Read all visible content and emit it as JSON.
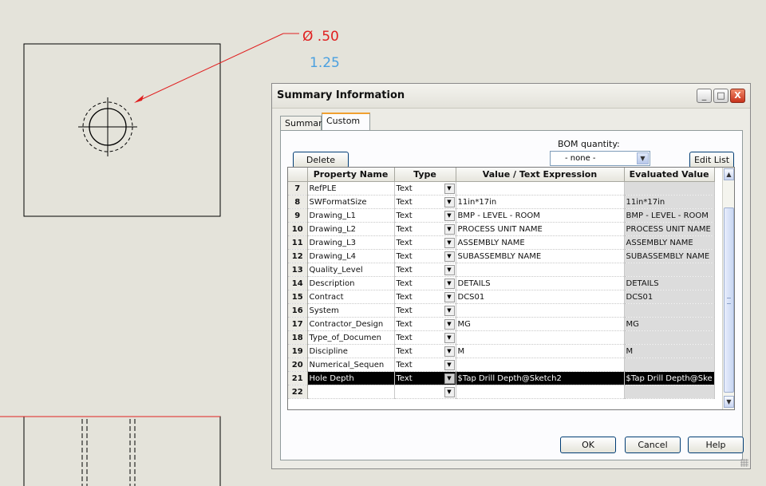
{
  "drawing": {
    "dim_diameter": "Ø .50",
    "dim_depth": "1.25"
  },
  "dialog": {
    "title": "Summary Information",
    "window_buttons": {
      "minimize": "_",
      "maximize": "□",
      "close": "X"
    },
    "tabs": [
      {
        "label": "Summary",
        "active": false
      },
      {
        "label": "Custom",
        "active": true
      }
    ],
    "delete_label": "Delete",
    "bom_label": "BOM quantity:",
    "bom_value": "- none -",
    "edit_list_label": "Edit List",
    "columns": [
      "Property Name",
      "Type",
      "Value / Text Expression",
      "Evaluated Value"
    ],
    "rows": [
      {
        "num": "7",
        "name": "RefPLE",
        "type": "Text",
        "value": "",
        "evaluated": ""
      },
      {
        "num": "8",
        "name": "SWFormatSize",
        "type": "Text",
        "value": "11in*17in",
        "evaluated": "11in*17in"
      },
      {
        "num": "9",
        "name": "Drawing_L1",
        "type": "Text",
        "value": "BMP - LEVEL - ROOM",
        "evaluated": "BMP - LEVEL - ROOM"
      },
      {
        "num": "10",
        "name": "Drawing_L2",
        "type": "Text",
        "value": "PROCESS UNIT NAME",
        "evaluated": "PROCESS UNIT NAME"
      },
      {
        "num": "11",
        "name": "Drawing_L3",
        "type": "Text",
        "value": "ASSEMBLY NAME",
        "evaluated": "ASSEMBLY NAME"
      },
      {
        "num": "12",
        "name": "Drawing_L4",
        "type": "Text",
        "value": "SUBASSEMBLY NAME",
        "evaluated": "SUBASSEMBLY NAME"
      },
      {
        "num": "13",
        "name": "Quality_Level",
        "type": "Text",
        "value": "",
        "evaluated": ""
      },
      {
        "num": "14",
        "name": "Description",
        "type": "Text",
        "value": "DETAILS",
        "evaluated": "DETAILS"
      },
      {
        "num": "15",
        "name": "Contract",
        "type": "Text",
        "value": "DCS01",
        "evaluated": "DCS01"
      },
      {
        "num": "16",
        "name": "System",
        "type": "Text",
        "value": "",
        "evaluated": ""
      },
      {
        "num": "17",
        "name": "Contractor_Design",
        "type": "Text",
        "value": "MG",
        "evaluated": "MG"
      },
      {
        "num": "18",
        "name": "Type_of_Documen",
        "type": "Text",
        "value": "",
        "evaluated": ""
      },
      {
        "num": "19",
        "name": "Discipline",
        "type": "Text",
        "value": "M",
        "evaluated": "M"
      },
      {
        "num": "20",
        "name": "Numerical_Sequen",
        "type": "Text",
        "value": "",
        "evaluated": ""
      },
      {
        "num": "21",
        "name": "Hole Depth",
        "type": "Text",
        "value": "$Tap Drill Depth@Sketch2",
        "evaluated": "$Tap Drill Depth@Ske",
        "selected": true
      },
      {
        "num": "22",
        "name": "",
        "type": "",
        "value": "",
        "evaluated": ""
      }
    ],
    "ok_label": "OK",
    "cancel_label": "Cancel",
    "help_label": "Help"
  },
  "colors": {
    "dimension_red": "#e02020",
    "dimension_blue": "#4aa0e0",
    "selection": "#000000"
  }
}
